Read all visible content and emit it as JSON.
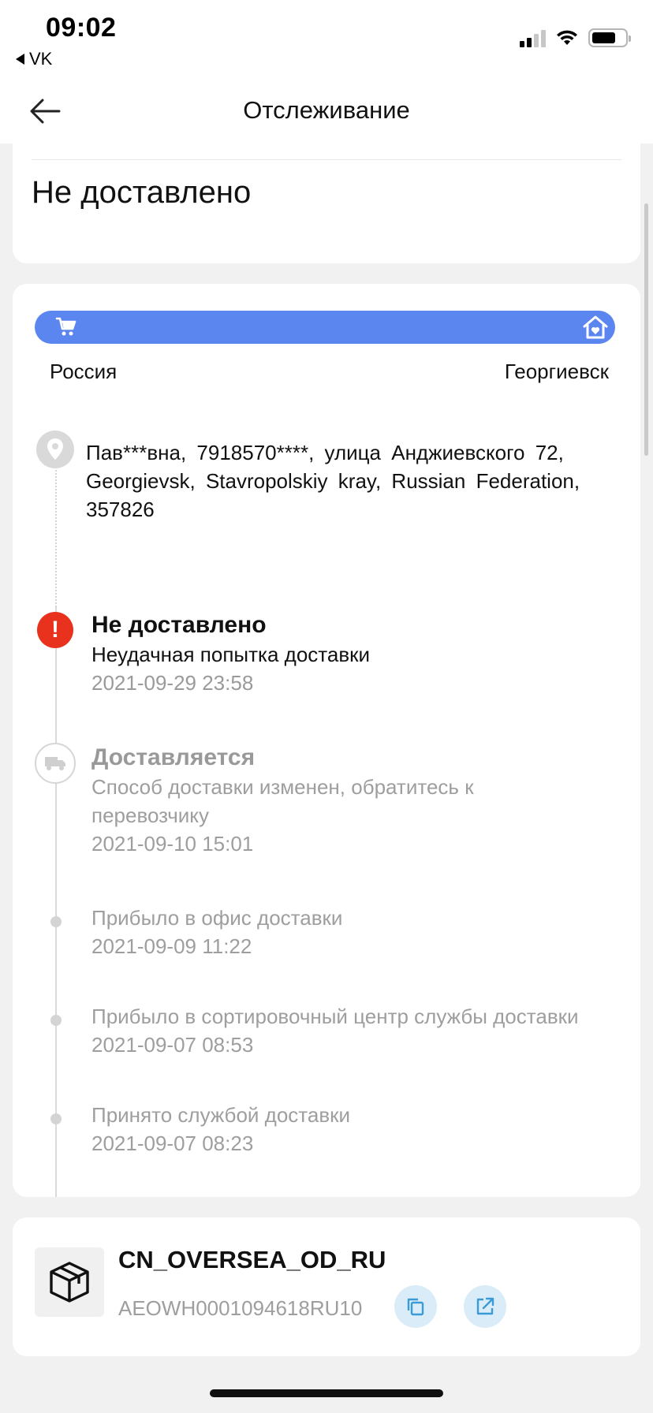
{
  "status_bar": {
    "time": "09:02",
    "back_app": "VK"
  },
  "header": {
    "title": "Отслеживание"
  },
  "summary": {
    "status": "Не доставлено"
  },
  "route": {
    "from": "Россия",
    "to": "Георгиевск"
  },
  "address": {
    "text": "Пав***вна, 7918570****, улица Анджиевского 72, Georgievsk, Stavropolskiy kray, Russian Federation, 357826"
  },
  "events": [
    {
      "title": "Не доставлено",
      "text": "Неудачная попытка доставки",
      "time": "2021-09-29 23:58"
    },
    {
      "title": "Доставляется",
      "text": "Способ доставки изменен, обратитесь к перевозчику",
      "time": "2021-09-10 15:01"
    },
    {
      "text": "Прибыло в офис доставки",
      "time": "2021-09-09 11:22"
    },
    {
      "text": "Прибыло в сортировочный центр службы доставки",
      "time": "2021-09-07 08:53"
    },
    {
      "text": "Принято службой доставки",
      "time": "2021-09-07 08:23"
    }
  ],
  "shipment": {
    "carrier": "CN_OVERSEA_OD_RU",
    "tracking_number": "AEOWH0001094618RU10"
  },
  "icons": {
    "back": "arrow-left-icon",
    "cart": "cart-icon",
    "home": "home-icon",
    "pin": "location-pin-icon",
    "alert": "alert-icon",
    "truck": "truck-icon",
    "package": "package-icon",
    "copy": "copy-icon",
    "open": "external-link-icon"
  },
  "colors": {
    "route_bar": "#5b86ef",
    "alert": "#e8321d",
    "action_bg": "#d9ecf7",
    "action_icon": "#3a9bd6"
  }
}
